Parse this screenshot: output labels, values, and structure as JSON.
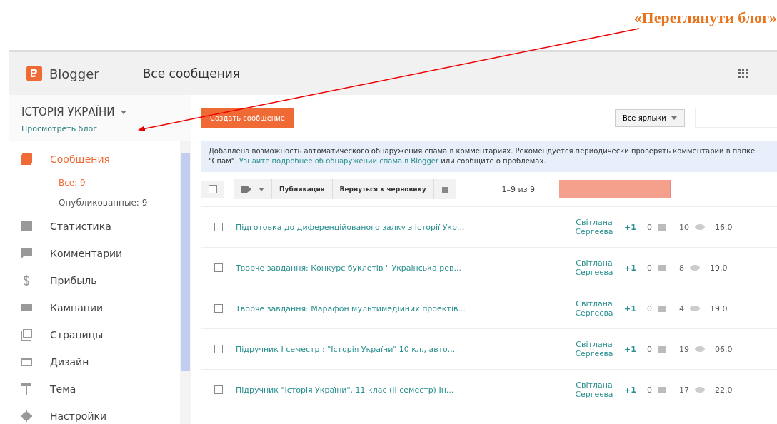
{
  "annotation": {
    "label": "«Переглянути блог»"
  },
  "header": {
    "brand": "Blogger",
    "title": "Все сообщения"
  },
  "blog": {
    "name": "ІСТОРІЯ УКРАЇНИ",
    "view_link": "Просмотреть блог"
  },
  "sidebar": {
    "items": [
      {
        "label": "Сообщения",
        "selected": true,
        "children": [
          {
            "label": "Все: 9",
            "selected": true
          },
          {
            "label": "Опубликованные: 9",
            "selected": false
          }
        ]
      },
      {
        "label": "Статистика",
        "selected": false
      },
      {
        "label": "Комментарии",
        "selected": false
      },
      {
        "label": "Прибыль",
        "selected": false
      },
      {
        "label": "Кампании",
        "selected": false
      },
      {
        "label": "Страницы",
        "selected": false
      },
      {
        "label": "Дизайн",
        "selected": false
      },
      {
        "label": "Тема",
        "selected": false
      },
      {
        "label": "Настройки",
        "selected": false
      }
    ]
  },
  "toolbar": {
    "create_button": "Создать сообщение",
    "labels_dropdown": "Все ярлыки"
  },
  "notice": {
    "text": "Добавлена возможность автоматического обнаружения спама в комментариях. Рекомендуется периодически проверять комментарии в папке \"Спам\".",
    "link": "Узнайте подробнее об обнаружении спама в Blogger",
    "tail": "или сообщите о проблемах."
  },
  "actions": {
    "select_all_checked": false,
    "publish": "Публикация",
    "revert": "Вернуться к черновику",
    "range": "1–9 из 9"
  },
  "posts": [
    {
      "title": "Підготовка до диференційованого залку з історії Укр...",
      "author": "Світлана Сергеєва",
      "plus": "+1",
      "comments": "0",
      "views": "10",
      "date": "16.0",
      "checked": false
    },
    {
      "title": "Творче завдання: Конкурс буклетів \" Українська рев...",
      "author": "Світлана Сергеєва",
      "plus": "+1",
      "comments": "0",
      "views": "8",
      "date": "19.0",
      "checked": false
    },
    {
      "title": "Творче завдання: Марафон мультимедійних проектів...",
      "author": "Світлана Сергеєва",
      "plus": "+1",
      "comments": "0",
      "views": "4",
      "date": "19.0",
      "checked": false
    },
    {
      "title": "Підручник І семестр : \"Історія України\" 10 кл., авто...",
      "author": "Світлана Сергеєва",
      "plus": "+1",
      "comments": "0",
      "views": "19",
      "date": "06.0",
      "checked": false
    },
    {
      "title": "Підручник \"Історія України\", 11 клас (ІІ семестр) Ін...",
      "author": "Світлана Сергеєва",
      "plus": "+1",
      "comments": "0",
      "views": "17",
      "date": "22.0",
      "checked": false
    }
  ]
}
